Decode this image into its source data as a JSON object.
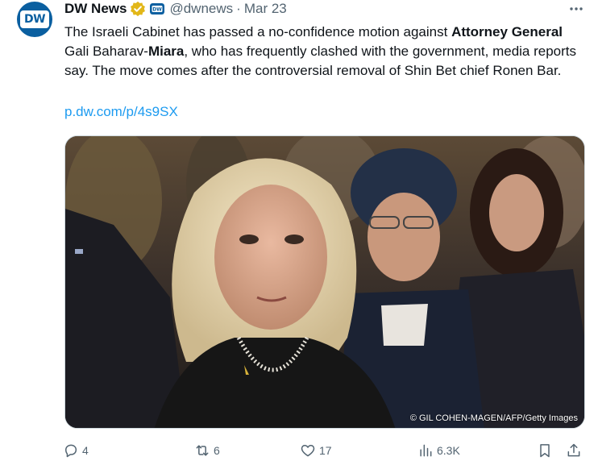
{
  "author": {
    "name": "DW News",
    "handle": "@dwnews",
    "separator": "·",
    "date": "Mar 23",
    "avatar_text": "DW"
  },
  "tweet": {
    "text_parts": [
      "The Israeli Cabinet has passed a no-confidence motion against ",
      "Attorney General",
      " Gali Baharav-",
      "Miara",
      ", who has frequently clashed with the government, media reports say. The move comes after the controversial removal of Shin Bet chief Ronen Bar."
    ],
    "link": "p.dw.com/p/4s9SX"
  },
  "media": {
    "credit": "© GIL COHEN-MAGEN/AFP/Getty Images"
  },
  "actions": {
    "replies": "4",
    "reposts": "6",
    "likes": "17",
    "views": "6.3K"
  },
  "colors": {
    "accent": "#1d9bf0",
    "secondary_text": "#536471",
    "verified": "#e2b719",
    "brand": "#0a5fa0"
  },
  "icons": [
    "more-icon",
    "verified-badge-icon",
    "affiliate-badge-icon",
    "reply-icon",
    "repost-icon",
    "like-icon",
    "views-icon",
    "bookmark-icon",
    "share-icon"
  ]
}
